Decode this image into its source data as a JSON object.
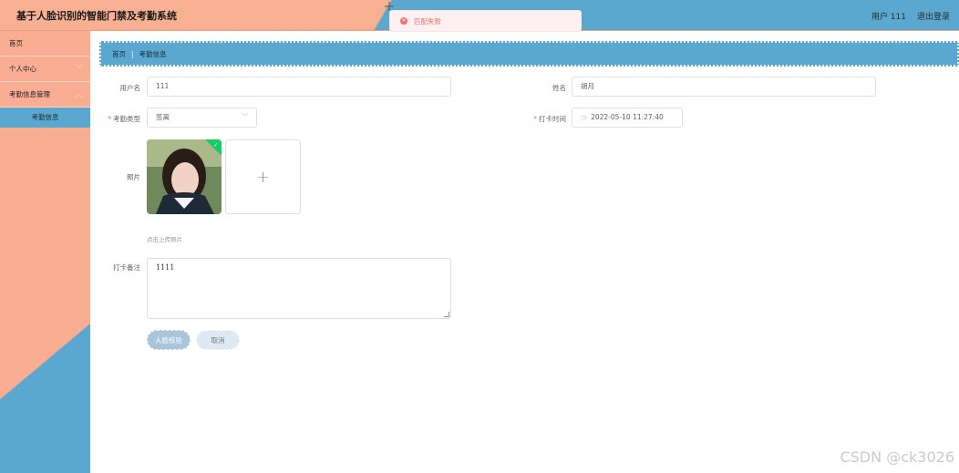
{
  "header": {
    "title": "基于人脸识别的智能门禁及考勤系统",
    "user_label": "用户 111",
    "logout": "退出登录"
  },
  "toast": {
    "message": "匹配失败",
    "icon": "error-circle-icon"
  },
  "sidebar": {
    "items": [
      {
        "label": "首页"
      },
      {
        "label": "个人中心"
      },
      {
        "label": "考勤信息管理"
      }
    ],
    "active_sub": "考勤信息"
  },
  "breadcrumb": {
    "home": "首页",
    "current": "考勤信息"
  },
  "form": {
    "username": {
      "label": "用户名",
      "value": "111"
    },
    "name": {
      "label": "姓名",
      "value": "胡月"
    },
    "attendance_type": {
      "label": "考勤类型",
      "value": "签离"
    },
    "checkin_time": {
      "label": "打卡时间",
      "value": "2022-05-10 11:27:40"
    },
    "photo": {
      "label": "照片",
      "hint": "点击上传照片"
    },
    "remark": {
      "label": "打卡备注",
      "value": "1111"
    }
  },
  "buttons": {
    "face_verify": "人脸核验",
    "cancel": "取消"
  },
  "watermark": "CSDN @ck3026",
  "colors": {
    "peach": "#f8b093",
    "blue": "#5aa7d0",
    "error": "#f56c6c"
  }
}
